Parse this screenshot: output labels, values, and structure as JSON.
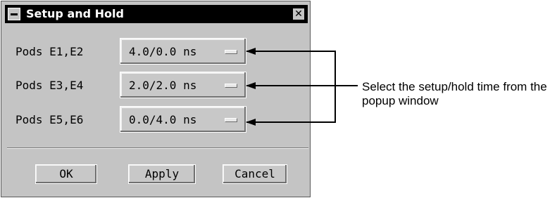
{
  "window": {
    "title": "Setup and Hold",
    "close_glyph": "✕"
  },
  "rows": [
    {
      "label": "Pods E1,E2",
      "value": "4.0/0.0 ns"
    },
    {
      "label": "Pods E3,E4",
      "value": "2.0/2.0 ns"
    },
    {
      "label": "Pods E5,E6",
      "value": "0.0/4.0 ns"
    }
  ],
  "buttons": {
    "ok": "OK",
    "apply": "Apply",
    "cancel": "Cancel"
  },
  "annotation": {
    "text": "Select the setup/hold time from the popup window"
  },
  "colors": {
    "window_bg": "#c4c4c4",
    "titlebar_bg": "#000000",
    "titlebar_text": "#ffffff"
  },
  "icons": {
    "window_menu": "window-menu-icon",
    "close": "close-icon",
    "option_menu": "option-menu-indicator-icon"
  }
}
